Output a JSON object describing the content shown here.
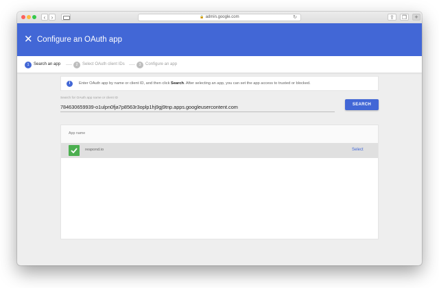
{
  "browser": {
    "url": "admin.google.com",
    "icons": {
      "lock": "lock-icon",
      "reload": "reload-icon",
      "back": "chevron-left-icon",
      "forward": "chevron-right-icon",
      "share": "share-icon",
      "tabs": "tabs-icon",
      "new_tab": "plus-icon"
    },
    "new_tab_label": "+"
  },
  "header": {
    "title": "Configure an OAuth app",
    "close_icon": "close-icon",
    "background_color": "#4267d6"
  },
  "stepper": {
    "steps": [
      {
        "number": "1",
        "label": "Search an app",
        "active": true
      },
      {
        "number": "2",
        "label": "Select OAuth client IDs",
        "active": false
      },
      {
        "number": "3",
        "label": "Configure an app",
        "active": false
      }
    ]
  },
  "info": {
    "icon": "info-icon",
    "text_before": "Enter OAuth app by name or client ID, and then click ",
    "text_bold": "Search",
    "text_after": ". After selecting an app, you can set the app access to trusted or blocked."
  },
  "search": {
    "label": "Search for OAuth app name or client ID",
    "value": "784630659939-o1ulpn0fja7p8563r3oplp1hj9gj9tnp.apps.googleusercontent.com",
    "button_label": "SEARCH"
  },
  "results": {
    "column_header": "App name",
    "rows": [
      {
        "app_name": "respond.io",
        "icon": "respond-io-logo-icon",
        "icon_color": "#4caf50",
        "action_label": "Select"
      }
    ]
  }
}
